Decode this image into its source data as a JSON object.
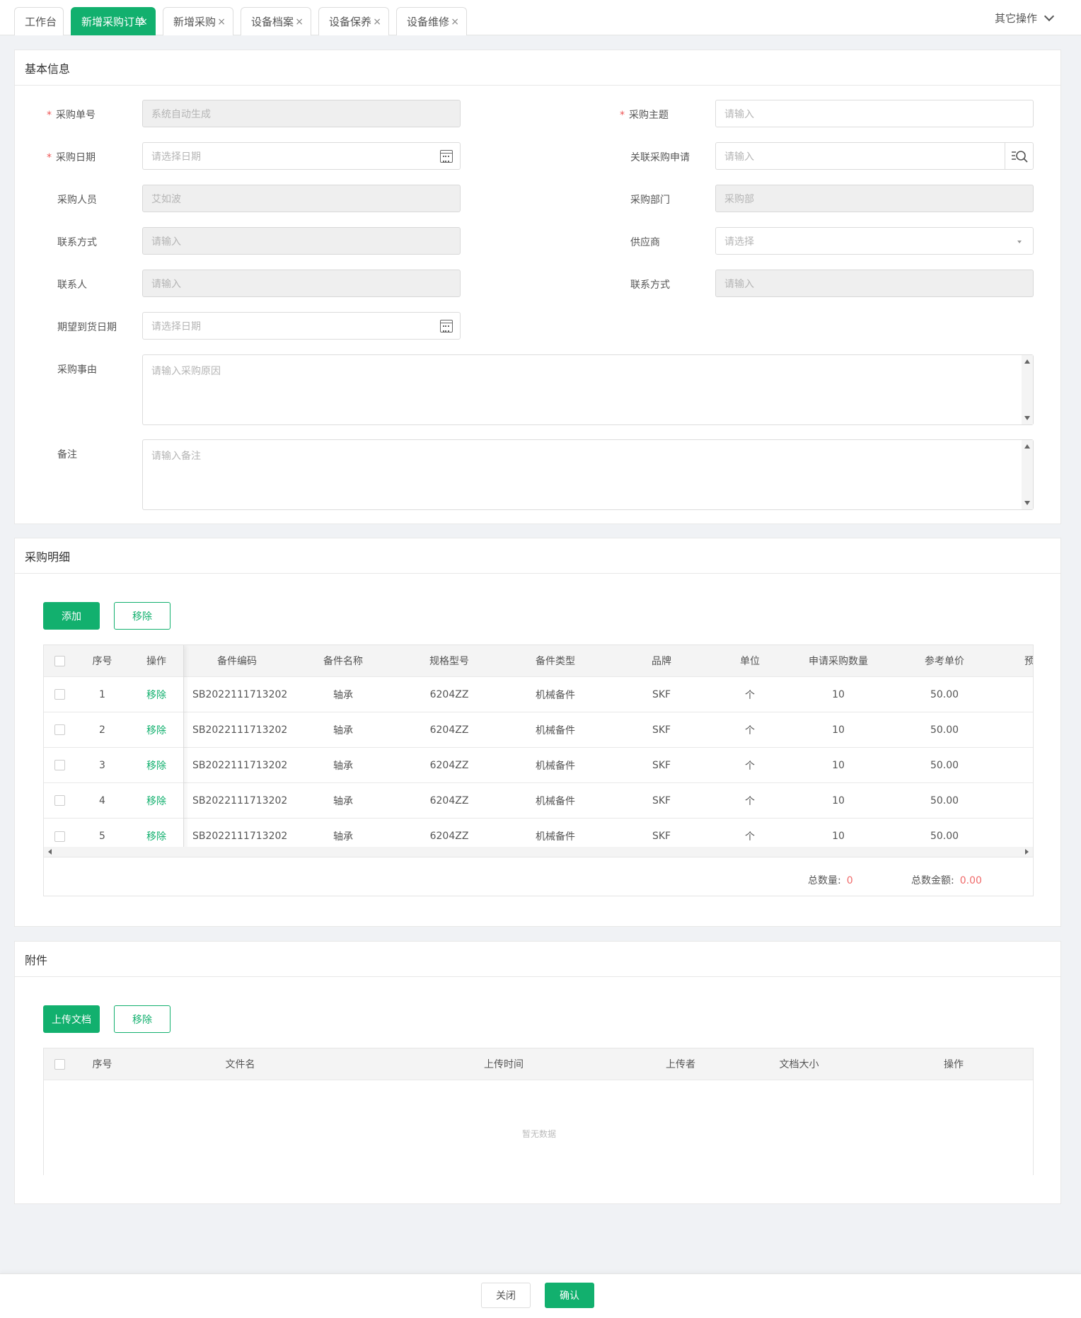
{
  "tabs": [
    {
      "label": "工作台",
      "closable": false,
      "active": false
    },
    {
      "label": "新增采购订单",
      "closable": true,
      "active": true
    },
    {
      "label": "新增采购",
      "closable": true,
      "active": false
    },
    {
      "label": "设备档案",
      "closable": true,
      "active": false
    },
    {
      "label": "设备保养",
      "closable": true,
      "active": false
    },
    {
      "label": "设备维修",
      "closable": true,
      "active": false
    }
  ],
  "tab_close_glyph": "×",
  "other_ops": "其它操作",
  "basic": {
    "title": "基本信息",
    "required_mark": "*",
    "order_no": {
      "label": "采购单号",
      "placeholder": "系统自动生成"
    },
    "subject": {
      "label": "采购主题",
      "placeholder": "请输入"
    },
    "date": {
      "label": "采购日期",
      "placeholder": "请选择日期"
    },
    "related": {
      "label": "关联采购申请",
      "placeholder": "请输入"
    },
    "buyer": {
      "label": "采购人员",
      "value": "艾如波"
    },
    "dept": {
      "label": "采购部门",
      "value": "采购部"
    },
    "contact_method": {
      "label": "联系方式",
      "placeholder": "请输入"
    },
    "supplier": {
      "label": "供应商",
      "placeholder": "请选择"
    },
    "contact_person": {
      "label": "联系人",
      "placeholder": "请输入"
    },
    "contact_method2": {
      "label": "联系方式",
      "placeholder": "请输入"
    },
    "expected_date": {
      "label": "期望到货日期",
      "placeholder": "请选择日期"
    },
    "reason": {
      "label": "采购事由",
      "placeholder": "请输入采购原因"
    },
    "remark": {
      "label": "备注",
      "placeholder": "请输入备注"
    }
  },
  "detail": {
    "title": "采购明细",
    "add_label": "添加",
    "remove_label": "移除",
    "columns": [
      "序号",
      "操作",
      "备件编码",
      "备件名称",
      "规格型号",
      "备件类型",
      "品牌",
      "单位",
      "申请采购数量",
      "参考单价",
      "预"
    ],
    "rows": [
      {
        "no": "1",
        "op": "移除",
        "code": "SB2022111713202",
        "name": "轴承",
        "spec": "6204ZZ",
        "type": "机械备件",
        "brand": "SKF",
        "unit": "个",
        "qty": "10",
        "price": "50.00"
      },
      {
        "no": "2",
        "op": "移除",
        "code": "SB2022111713202",
        "name": "轴承",
        "spec": "6204ZZ",
        "type": "机械备件",
        "brand": "SKF",
        "unit": "个",
        "qty": "10",
        "price": "50.00"
      },
      {
        "no": "3",
        "op": "移除",
        "code": "SB2022111713202",
        "name": "轴承",
        "spec": "6204ZZ",
        "type": "机械备件",
        "brand": "SKF",
        "unit": "个",
        "qty": "10",
        "price": "50.00"
      },
      {
        "no": "4",
        "op": "移除",
        "code": "SB2022111713202",
        "name": "轴承",
        "spec": "6204ZZ",
        "type": "机械备件",
        "brand": "SKF",
        "unit": "个",
        "qty": "10",
        "price": "50.00"
      },
      {
        "no": "5",
        "op": "移除",
        "code": "SB2022111713202",
        "name": "轴承",
        "spec": "6204ZZ",
        "type": "机械备件",
        "brand": "SKF",
        "unit": "个",
        "qty": "10",
        "price": "50.00"
      }
    ],
    "total_qty_label": "总数量:",
    "total_qty": "0",
    "total_amount_label": "总数金额:",
    "total_amount": "0.00"
  },
  "attachments": {
    "title": "附件",
    "upload_label": "上传文档",
    "remove_label": "移除",
    "columns": [
      "序号",
      "文件名",
      "上传时间",
      "上传者",
      "文档大小",
      "操作"
    ],
    "empty_text": "暂无数据"
  },
  "footer": {
    "close_label": "关闭",
    "confirm_label": "确认"
  },
  "colors": {
    "accent": "#12b06e",
    "danger": "#f06a6a"
  }
}
